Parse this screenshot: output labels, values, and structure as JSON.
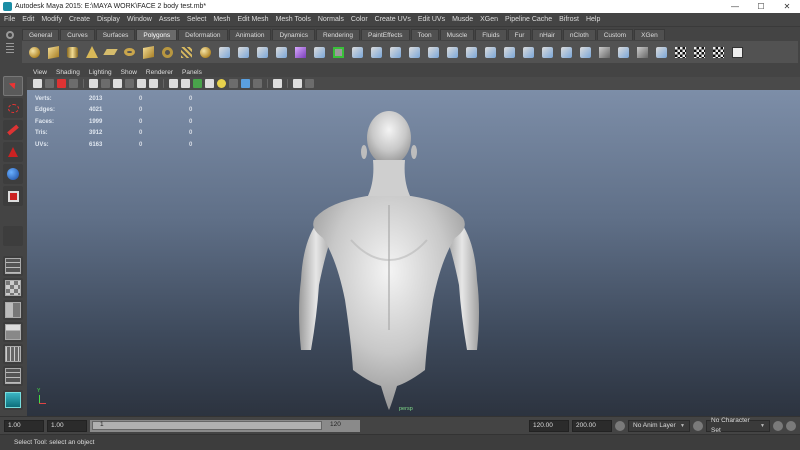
{
  "window": {
    "title": "Autodesk Maya 2015: E:\\MAYA WORK\\FACE 2 body test.mb*",
    "controls": {
      "minimize": "—",
      "maximize": "☐",
      "close": "✕"
    }
  },
  "menus": [
    "File",
    "Edit",
    "Modify",
    "Create",
    "Display",
    "Window",
    "Assets",
    "Select",
    "Mesh",
    "Edit Mesh",
    "Mesh Tools",
    "Normals",
    "Color",
    "Create UVs",
    "Edit UVs",
    "Musde",
    "XGen",
    "Pipeline Cache",
    "Bifrost",
    "Help"
  ],
  "shelf": {
    "tabs": [
      "General",
      "Curves",
      "Surfaces",
      "Polygons",
      "Deformation",
      "Animation",
      "Dynamics",
      "Rendering",
      "PaintEffects",
      "Toon",
      "Muscle",
      "Fluids",
      "Fur",
      "nHair",
      "nCloth",
      "Custom",
      "XGen"
    ],
    "active_tab": "Polygons",
    "icons": [
      "poly-sphere-icon",
      "poly-cube-icon",
      "poly-cylinder-icon",
      "poly-cone-icon",
      "poly-plane-icon",
      "poly-torus-icon",
      "poly-prism-icon",
      "poly-pipe-icon",
      "poly-helix-icon",
      "poly-soccer-icon",
      "combine-icon",
      "separate-icon",
      "extract-icon",
      "smooth-icon",
      "boolean-icon",
      "average-icon",
      "bridge-icon",
      "append-icon",
      "fill-hole-icon",
      "split-icon",
      "insert-edge-icon",
      "offset-edge-icon",
      "bevel-icon",
      "extrude-icon",
      "merge-icon",
      "wedge-icon",
      "poke-icon",
      "cut-icon",
      "reduce-icon",
      "cleanup-icon",
      "triangulate-icon",
      "quadrangulate-icon",
      "mirror-icon",
      "planar-map-icon",
      "cylindrical-map-icon",
      "spherical-map-icon",
      "auto-map-icon",
      "uv-editor-icon"
    ]
  },
  "panel": {
    "menus": [
      "View",
      "Shading",
      "Lighting",
      "Show",
      "Renderer",
      "Panels"
    ]
  },
  "hud": {
    "rows": [
      {
        "label": "Verts:",
        "v1": "2013",
        "v2": "0",
        "v3": "0"
      },
      {
        "label": "Edges:",
        "v1": "4021",
        "v2": "0",
        "v3": "0"
      },
      {
        "label": "Faces:",
        "v1": "1999",
        "v2": "0",
        "v3": "0"
      },
      {
        "label": "Tris:",
        "v1": "3912",
        "v2": "0",
        "v3": "0"
      },
      {
        "label": "UVs:",
        "v1": "6163",
        "v2": "0",
        "v3": "0"
      }
    ],
    "camera": "persp",
    "axis_y": "Y"
  },
  "timeslider": {
    "start_time": "1.00",
    "playback_start": "1.00",
    "range_start": "1",
    "range_end": "120",
    "playback_end": "120.00",
    "end_time": "200.00",
    "anim_layer": "No Anim Layer",
    "character_set": "No Character Set"
  },
  "help_line": "Select Tool: select an object",
  "colors": {
    "viewport_top": "#7d8ea8",
    "viewport_bottom": "#2c333f",
    "ui_bg": "#444444",
    "active_tab": "#6a6a6a"
  }
}
